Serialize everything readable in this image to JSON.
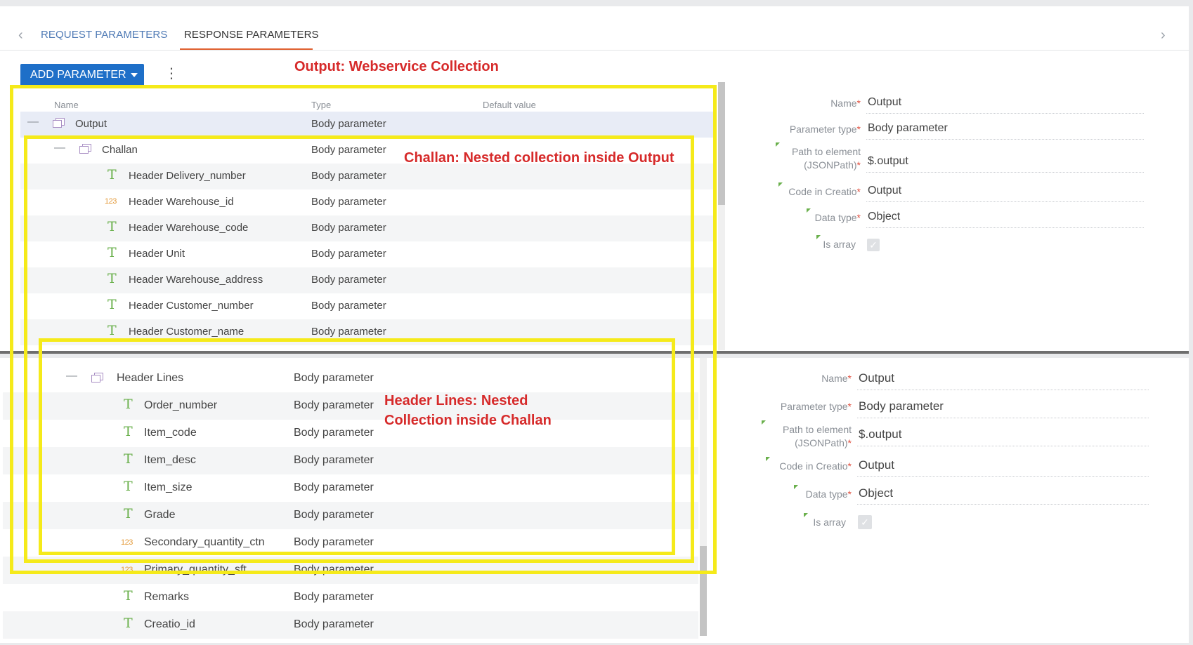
{
  "tabs": {
    "request": "REQUEST PARAMETERS",
    "response": "RESPONSE PARAMETERS"
  },
  "toolbar": {
    "add_parameter": "ADD PARAMETER"
  },
  "columns": {
    "name": "Name",
    "type": "Type",
    "default_value": "Default value"
  },
  "top_rows": [
    {
      "name": "Output",
      "type": "Body parameter",
      "icon": "object-icon"
    },
    {
      "name": "Challan",
      "type": "Body parameter",
      "icon": "object-icon"
    },
    {
      "name": "Header Delivery_number",
      "type": "Body parameter",
      "icon": "text-type-icon"
    },
    {
      "name": "Header Warehouse_id",
      "type": "Body parameter",
      "icon": "number-type-icon"
    },
    {
      "name": "Header Warehouse_code",
      "type": "Body parameter",
      "icon": "text-type-icon"
    },
    {
      "name": "Header Unit",
      "type": "Body parameter",
      "icon": "text-type-icon"
    },
    {
      "name": "Header Warehouse_address",
      "type": "Body parameter",
      "icon": "text-type-icon"
    },
    {
      "name": "Header Customer_number",
      "type": "Body parameter",
      "icon": "text-type-icon"
    },
    {
      "name": "Header Customer_name",
      "type": "Body parameter",
      "icon": "text-type-icon"
    }
  ],
  "bottom_rows": [
    {
      "name": "Header Lines",
      "type": "Body parameter",
      "icon": "object-icon"
    },
    {
      "name": "Order_number",
      "type": "Body parameter",
      "icon": "text-type-icon"
    },
    {
      "name": "Item_code",
      "type": "Body parameter",
      "icon": "text-type-icon"
    },
    {
      "name": "Item_desc",
      "type": "Body parameter",
      "icon": "text-type-icon"
    },
    {
      "name": "Item_size",
      "type": "Body parameter",
      "icon": "text-type-icon"
    },
    {
      "name": "Grade",
      "type": "Body parameter",
      "icon": "text-type-icon"
    },
    {
      "name": "Secondary_quantity_ctn",
      "type": "Body parameter",
      "icon": "number-type-icon"
    },
    {
      "name": "Primary_quantity_sft",
      "type": "Body parameter",
      "icon": "number-type-icon"
    },
    {
      "name": "Remarks",
      "type": "Body parameter",
      "icon": "text-type-icon"
    },
    {
      "name": "Creatio_id",
      "type": "Body parameter",
      "icon": "text-type-icon"
    }
  ],
  "details": {
    "name_label": "Name",
    "name_value": "Output",
    "param_type_label": "Parameter type",
    "param_type_value": "Body parameter",
    "path_label_1": "Path to element",
    "path_label_2": "(JSONPath)",
    "path_value": "$.output",
    "code_label": "Code in Creatio",
    "code_value": "Output",
    "data_type_label": "Data type",
    "data_type_value": "Object",
    "is_array_label": "Is array",
    "is_array_checked": true,
    "required_mark": "*"
  },
  "annotations": {
    "output": "Output: Webservice Collection",
    "challan": "Challan: Nested collection inside Output",
    "header_lines_1": "Header Lines: Nested",
    "header_lines_2": "Collection inside Challan"
  },
  "colors": {
    "accent_blue": "#1e6fc8",
    "tab_underline": "#e06030",
    "annotation_red": "#d62a2a",
    "highlight_yellow": "#f5ea1a",
    "text_icon_green": "#6ab04c",
    "number_icon_orange": "#e39a3a"
  }
}
